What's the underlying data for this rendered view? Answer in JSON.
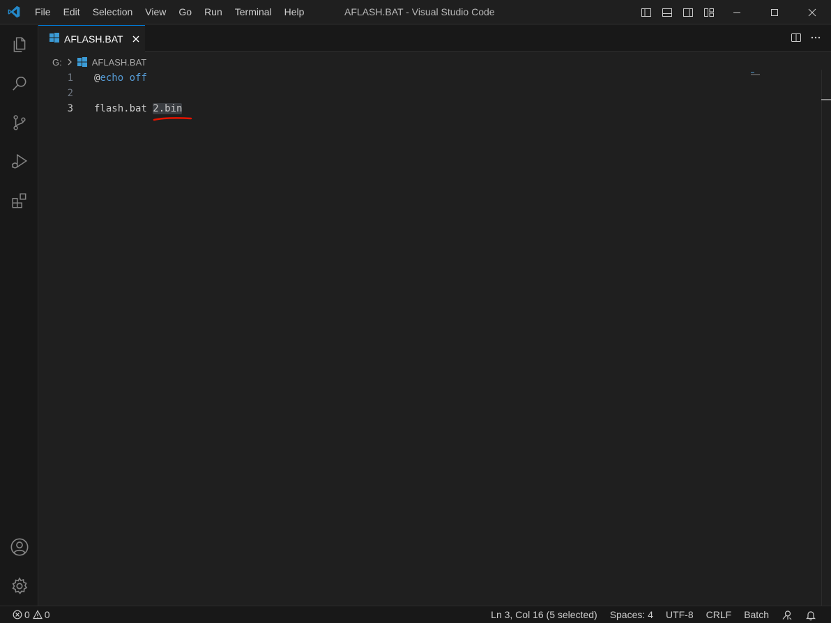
{
  "titlebar": {
    "menu": [
      "File",
      "Edit",
      "Selection",
      "View",
      "Go",
      "Run",
      "Terminal",
      "Help"
    ],
    "window_title": "AFLASH.BAT - Visual Studio Code"
  },
  "tabs": [
    {
      "label": "AFLASH.BAT",
      "active": true
    }
  ],
  "breadcrumb": {
    "drive": "G:",
    "file": "AFLASH.BAT"
  },
  "editor": {
    "lines": [
      {
        "number": "1",
        "at": "@",
        "keyword": "echo off",
        "text": ""
      },
      {
        "number": "2",
        "text": ""
      },
      {
        "number": "3",
        "text": "flash.bat ",
        "selected": "2.bin"
      }
    ],
    "active_line": 3
  },
  "statusbar": {
    "errors": "0",
    "warnings": "0",
    "position": "Ln 3, Col 16 (5 selected)",
    "indent": "Spaces: 4",
    "encoding": "UTF-8",
    "eol": "CRLF",
    "language": "Batch"
  },
  "colors": {
    "accent": "#0078d4",
    "keyword": "#569cd6",
    "annotation_underline": "#e51400"
  }
}
